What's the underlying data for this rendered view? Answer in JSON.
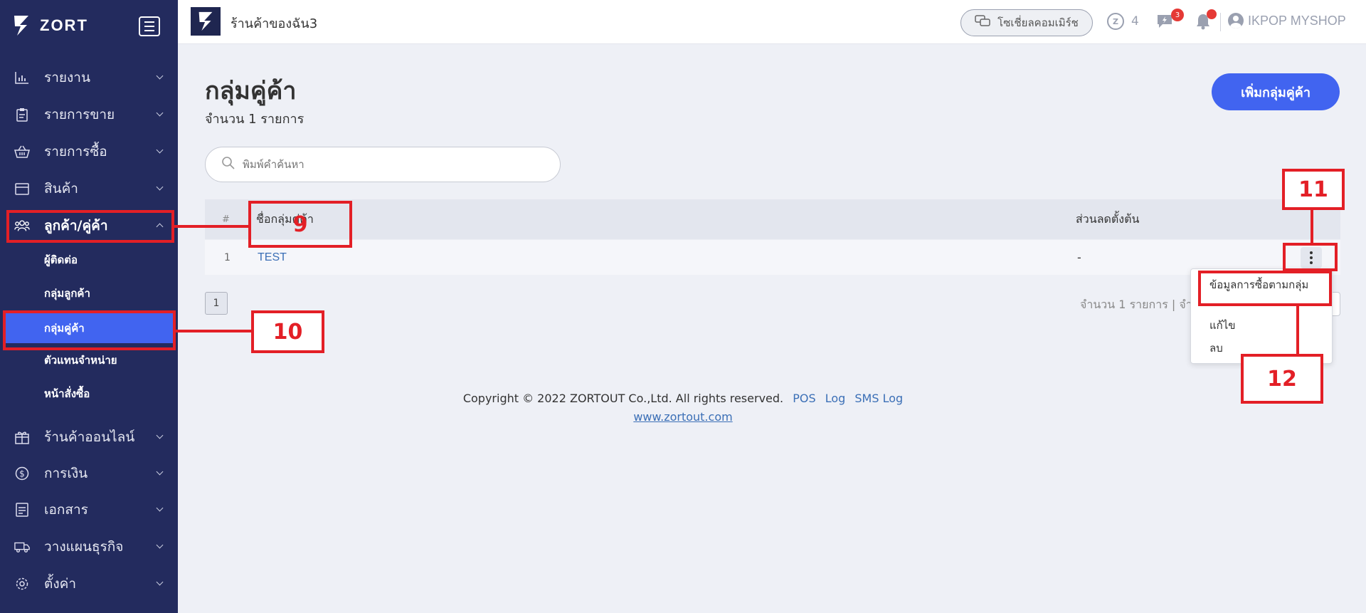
{
  "brand": {
    "name": "ZORT"
  },
  "sidebar": {
    "items": [
      {
        "label": "รายงาน",
        "icon": "bar-chart-icon"
      },
      {
        "label": "รายการขาย",
        "icon": "clipboard-icon"
      },
      {
        "label": "รายการซื้อ",
        "icon": "basket-icon"
      },
      {
        "label": "สินค้า",
        "icon": "box-icon"
      },
      {
        "label": "ลูกค้า/คู่ค้า",
        "icon": "users-icon"
      },
      {
        "label": "ร้านค้าออนไลน์",
        "icon": "gift-icon"
      },
      {
        "label": "การเงิน",
        "icon": "dollar-icon"
      },
      {
        "label": "เอกสาร",
        "icon": "document-icon"
      },
      {
        "label": "วางแผนธุรกิจ",
        "icon": "truck-icon"
      },
      {
        "label": "ตั้งค่า",
        "icon": "gear-icon"
      }
    ],
    "sub_items": [
      "ผู้ติดต่อ",
      "กลุ่มลูกค้า",
      "กลุ่มคู่ค้า",
      "ตัวแทนจำหน่าย",
      "หน้าสั่งซื้อ"
    ]
  },
  "topbar": {
    "shop_name": "ร้านค้าของฉัน3",
    "social_commerce": "โซเชี่ยลคอมเมิร์ช",
    "coins": "4",
    "chat_badge": "3",
    "user": "IKPOP MYSHOP"
  },
  "main": {
    "title": "กลุ่มคู่ค้า",
    "count": "จำนวน 1 รายการ",
    "add_button": "เพิ่มกลุ่มคู่ค้า",
    "search_placeholder": "พิมพ์คำค้นหา",
    "table": {
      "headers": [
        "#",
        "ชื่อกลุ่มคู่ค้า",
        "ส่วนลดตั้งต้น"
      ],
      "rows": [
        {
          "num": "1",
          "name": "TEST",
          "discount": "-"
        }
      ]
    },
    "pager": {
      "page": "1",
      "info": "จำนวน 1 รายการ | จำนว"
    },
    "dropdown": [
      "ข้อมูลการซื้อตามกลุ่ม",
      "แก้ไข",
      "ลบ"
    ]
  },
  "footer": {
    "copyright": "Copyright © 2022 ZORTOUT Co.,Ltd. All rights reserved.",
    "links": [
      "POS",
      "Log",
      "SMS Log"
    ],
    "url": "www.zortout.com"
  },
  "annotations": [
    "9",
    "10",
    "11",
    "12"
  ],
  "colors": {
    "sidebar": "#232b5e",
    "accent": "#4164f0",
    "annotation": "#e31f26"
  }
}
